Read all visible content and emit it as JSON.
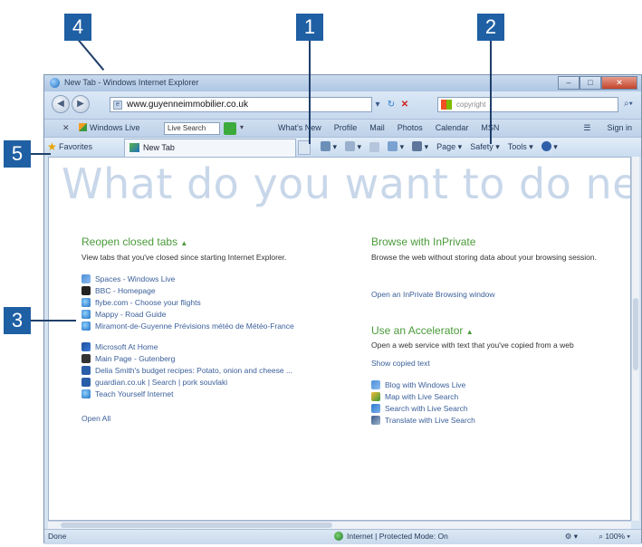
{
  "callouts": [
    "1",
    "2",
    "3",
    "4",
    "5"
  ],
  "window": {
    "title": "New Tab - Windows Internet Explorer"
  },
  "address_bar": {
    "url": "www.guyenneimmobilier.co.uk"
  },
  "search_box": {
    "placeholder": "copyright"
  },
  "links_bar": {
    "close": "✕",
    "logo": "Windows Live",
    "search_text": "Live Search",
    "links": [
      "What's New",
      "Profile",
      "Mail",
      "Photos",
      "Calendar",
      "MSN"
    ],
    "sign_in": "Sign in"
  },
  "tab_bar": {
    "favorites": "Favorites",
    "tab_label": "New Tab",
    "commands": {
      "page": "Page",
      "safety": "Safety",
      "tools": "Tools"
    }
  },
  "content": {
    "headline": "What do you want to do next?",
    "reopen": {
      "title": "Reopen closed tabs",
      "desc": "View tabs that you've closed since starting Internet Explorer.",
      "items": [
        "Spaces - Windows Live",
        "BBC - Homepage",
        "flybe.com - Choose your flights",
        "Mappy - Road Guide",
        "Miramont-de-Guyenne Prévisions météo de Météo-France",
        "Microsoft At Home",
        "Main Page - Gutenberg",
        "Delia Smith's budget recipes: Potato, onion and cheese ...",
        "guardian.co.uk | Search | pork souvlaki",
        "Teach Yourself Internet"
      ],
      "open_all": "Open All"
    },
    "inprivate": {
      "title": "Browse with InPrivate",
      "desc": "Browse the web without storing data about your browsing session.",
      "link": "Open an InPrivate Browsing window"
    },
    "accelerator": {
      "title": "Use an Accelerator",
      "desc": "Open a web service with text that you've copied from a web",
      "show": "Show copied text",
      "items": [
        "Blog with Windows Live",
        "Map with Live Search",
        "Search with Live Search",
        "Translate with Live Search"
      ]
    }
  },
  "status_bar": {
    "left": "Done",
    "zone": "Internet | Protected Mode: On",
    "zoom": "100%"
  }
}
